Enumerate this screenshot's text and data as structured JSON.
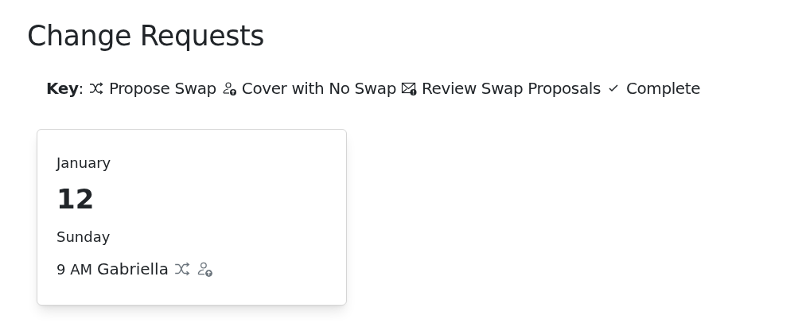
{
  "title": "Change Requests",
  "key": {
    "label": "**Key**:",
    "items": [
      {
        "kind": "shuffle",
        "label": "Propose Swap"
      },
      {
        "kind": "person-up",
        "label": "Cover with No Swap"
      },
      {
        "kind": "mail-alert",
        "label": "Review Swap Proposals"
      },
      {
        "kind": "check",
        "label": "Complete"
      }
    ]
  },
  "cards": [
    {
      "month": "January",
      "day": "12",
      "weekday": "Sunday",
      "shifts": [
        {
          "time": "9 AM",
          "person": "Gabriella",
          "actions": [
            {
              "kind": "shuffle"
            },
            {
              "kind": "person-up"
            }
          ]
        }
      ]
    }
  ]
}
